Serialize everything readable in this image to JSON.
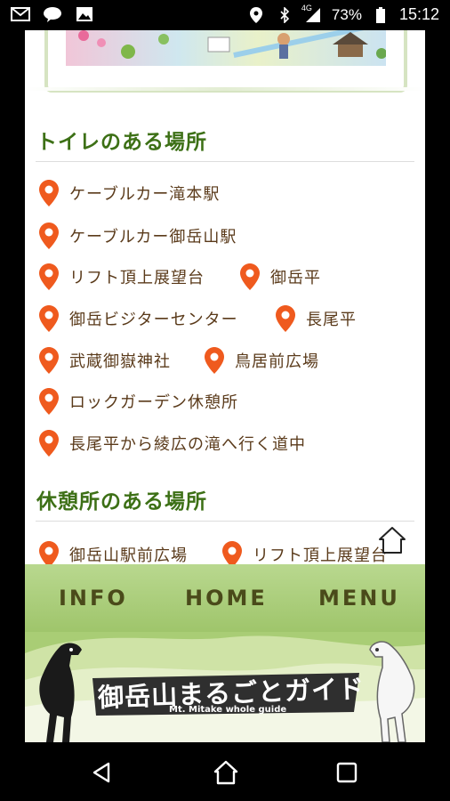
{
  "status_bar": {
    "notifications": [
      "gmail-icon",
      "line-icon",
      "image-icon"
    ],
    "network": "4G",
    "battery": "73%",
    "time": "15:12"
  },
  "sections": [
    {
      "title": "トイレのある場所",
      "items": [
        "ケーブルカー滝本駅",
        "ケーブルカー御岳山駅",
        "リフト頂上展望台",
        "御岳平",
        "御岳ビジターセンター",
        "長尾平",
        "武蔵御嶽神社",
        "鳥居前広場",
        "ロックガーデン休憩所",
        "長尾平から綾広の滝へ行く道中"
      ]
    },
    {
      "title": "休憩所のある場所",
      "items": [
        "御岳山駅前広場",
        "リフト頂上展望台"
      ]
    }
  ],
  "footer": {
    "nav": {
      "info": "INFO",
      "home": "HOME",
      "menu": "MENU"
    },
    "banner_title": "御岳山まるごとガイド",
    "banner_subtitle": "Mt. Mitake whole guide"
  },
  "colors": {
    "heading": "#3d7016",
    "pin": "#ef5a1e",
    "item_text": "#5a3a1a",
    "footer_green": "#a9cd75"
  }
}
